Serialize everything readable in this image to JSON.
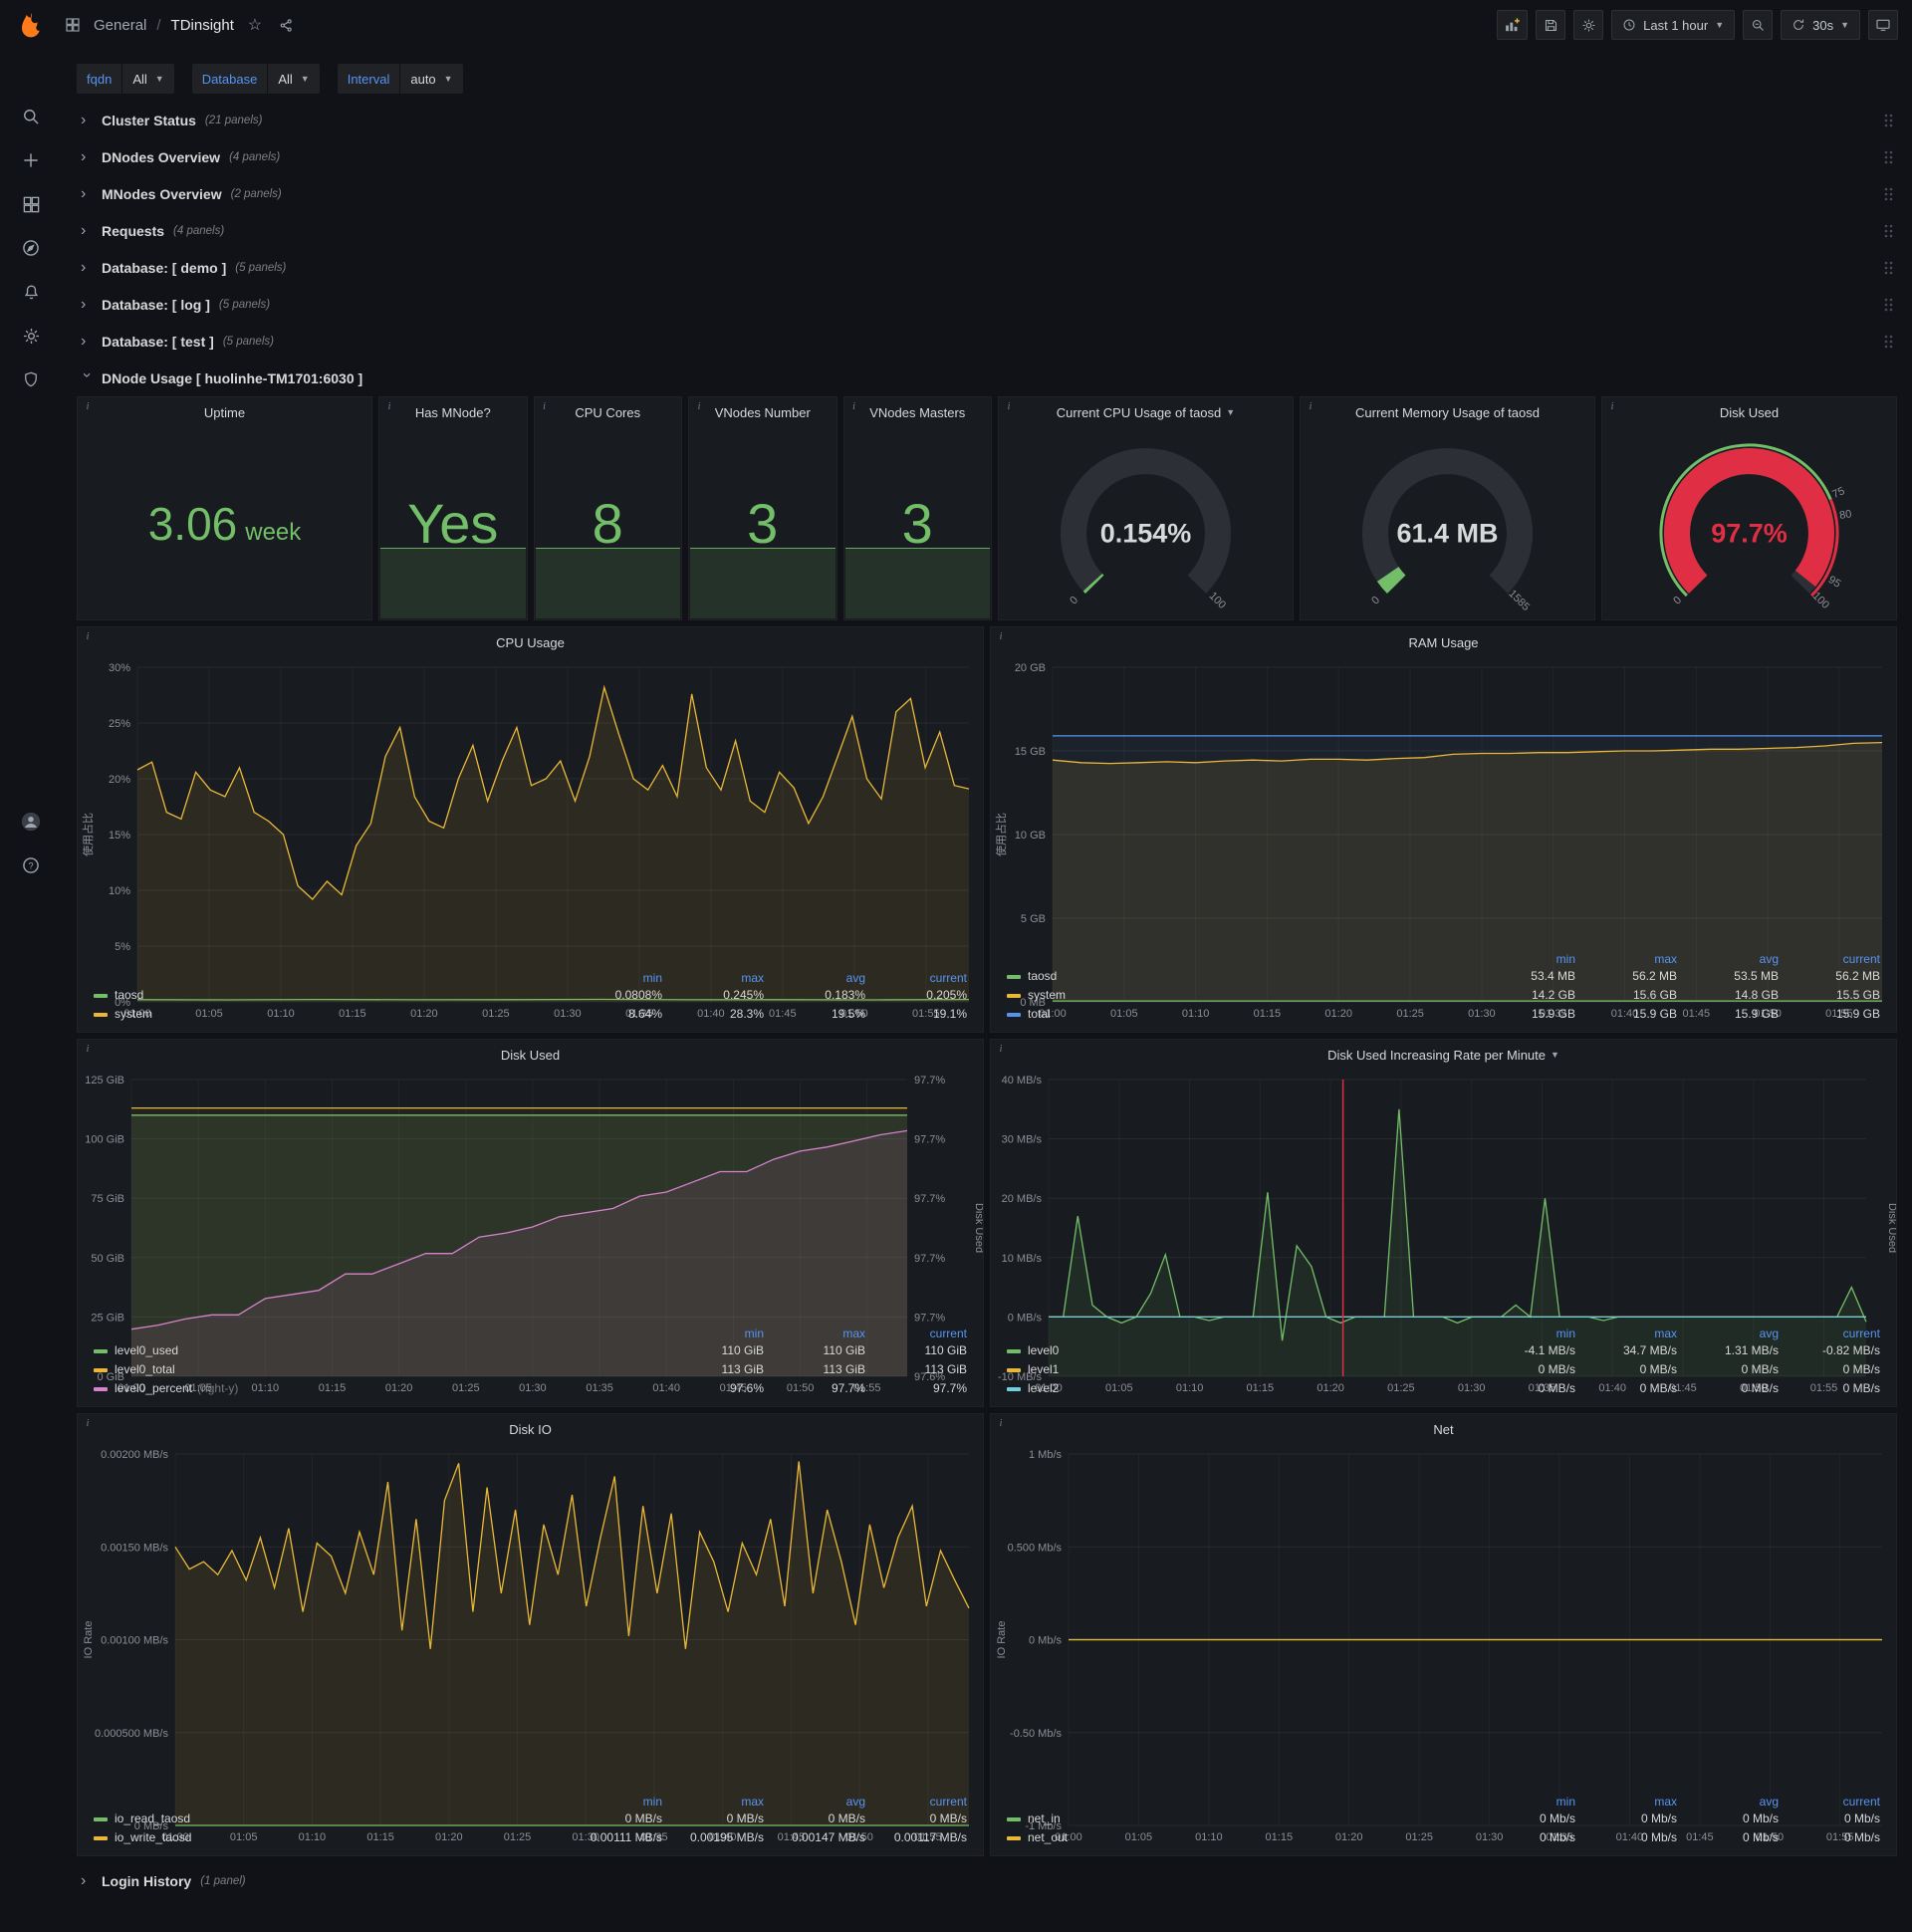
{
  "navbar": {
    "section": "General",
    "separator": "/",
    "title": "TDinsight",
    "time_range": "Last 1 hour",
    "refresh": "30s"
  },
  "filters": {
    "fqdn": {
      "label": "fqdn",
      "value": "All"
    },
    "database": {
      "label": "Database",
      "value": "All"
    },
    "interval": {
      "label": "Interval",
      "value": "auto"
    }
  },
  "rows": [
    {
      "title": "Cluster Status",
      "count": "(21 panels)"
    },
    {
      "title": "DNodes Overview",
      "count": "(4 panels)"
    },
    {
      "title": "MNodes Overview",
      "count": "(2 panels)"
    },
    {
      "title": "Requests",
      "count": "(4 panels)"
    },
    {
      "title": "Database: [ demo ]",
      "count": "(5 panels)"
    },
    {
      "title": "Database: [ log ]",
      "count": "(5 panels)"
    },
    {
      "title": "Database: [ test ]",
      "count": "(5 panels)"
    }
  ],
  "dnode_row": {
    "title": "DNode Usage [ huolinhe-TM1701:6030 ]"
  },
  "login_row": {
    "title": "Login History",
    "count": "(1 panel)"
  },
  "stats": {
    "uptime": {
      "title": "Uptime",
      "value": "3.06",
      "unit": "week"
    },
    "mnode": {
      "title": "Has MNode?",
      "value": "Yes"
    },
    "cores": {
      "title": "CPU Cores",
      "value": "8"
    },
    "vnodes": {
      "title": "VNodes Number",
      "value": "3"
    },
    "masters": {
      "title": "VNodes Masters",
      "value": "3"
    }
  },
  "gauges": {
    "cpu": {
      "title": "Current CPU Usage of taosd",
      "value": "0.154%",
      "fraction": 0.0022,
      "color": "#73bf69",
      "value_color": "#d8d9da",
      "threshold": false,
      "ticks": [
        {
          "v": 0,
          "label": "0"
        },
        {
          "v": 1,
          "label": "100"
        }
      ]
    },
    "mem": {
      "title": "Current Memory Usage of taosd",
      "value": "61.4 MB",
      "fraction": 0.039,
      "color": "#73bf69",
      "value_color": "#d8d9da",
      "threshold": false,
      "ticks": [
        {
          "v": 0,
          "label": "0"
        },
        {
          "v": 1,
          "label": "1585"
        }
      ]
    },
    "disk": {
      "title": "Disk Used",
      "value": "97.7%",
      "fraction": 0.977,
      "color": "#e02f44",
      "value_color": "#e02f44",
      "threshold": true,
      "ticks": [
        {
          "v": 0,
          "label": "0"
        },
        {
          "v": 0.75,
          "label": "75"
        },
        {
          "v": 0.8,
          "label": "80"
        },
        {
          "v": 0.95,
          "label": "95"
        },
        {
          "v": 1,
          "label": "100"
        }
      ]
    }
  },
  "charts": {
    "cpu": {
      "type": "line",
      "title": "CPU Usage",
      "y_label": "使用占比",
      "pad_left": 44,
      "y_min": 0,
      "y_max": 30,
      "y_ticks": [
        {
          "v": 0,
          "label": "0%"
        },
        {
          "v": 5,
          "label": "5%"
        },
        {
          "v": 10,
          "label": "10%"
        },
        {
          "v": 15,
          "label": "15%"
        },
        {
          "v": 20,
          "label": "20%"
        },
        {
          "v": 25,
          "label": "25%"
        },
        {
          "v": 30,
          "label": "30%"
        }
      ],
      "x_labels": [
        "01:00",
        "01:05",
        "01:10",
        "01:15",
        "01:20",
        "01:25",
        "01:30",
        "01:35",
        "01:40",
        "01:45",
        "01:50",
        "01:55"
      ],
      "series": [
        {
          "name": "taosd",
          "color": "#73bf69",
          "fill": 0,
          "values": [
            0.2,
            0.18,
            0.21,
            0.19,
            0.2,
            0.22,
            0.19,
            0.2,
            0.18,
            0.21
          ]
        },
        {
          "name": "system",
          "color": "#eab839",
          "fill": 0.1,
          "values": [
            20.8,
            21.5,
            17,
            16.4,
            20.6,
            19,
            18.4,
            21,
            17,
            16.2,
            15,
            10.4,
            9.2,
            10.8,
            9.6,
            14,
            16,
            22,
            24.6,
            18.4,
            16.2,
            15.6,
            20,
            23,
            18,
            21.6,
            24.6,
            19.4,
            20,
            21.6,
            18,
            22,
            28.2,
            24,
            20,
            19,
            21.2,
            18.4,
            27.6,
            21,
            19,
            23.4,
            18,
            17,
            20.6,
            19.2,
            16,
            18.4,
            22,
            25.6,
            20,
            18.2,
            26,
            27.2,
            21,
            24.2,
            19.4,
            19.1
          ]
        }
      ],
      "legend": {
        "columns": [
          "min",
          "max",
          "avg",
          "current"
        ],
        "rows": [
          {
            "name": "taosd",
            "color": "#73bf69",
            "values": [
              "0.0808%",
              "0.245%",
              "0.183%",
              "0.205%"
            ]
          },
          {
            "name": "system",
            "color": "#eab839",
            "values": [
              "8.64%",
              "28.3%",
              "19.5%",
              "19.1%"
            ]
          }
        ]
      }
    },
    "ram": {
      "type": "line",
      "title": "RAM Usage",
      "y_label": "使用占比",
      "pad_left": 46,
      "y_min": 0,
      "y_max": 20,
      "y_ticks": [
        {
          "v": 0,
          "label": "0 MB"
        },
        {
          "v": 5,
          "label": "5 GB"
        },
        {
          "v": 10,
          "label": "10 GB"
        },
        {
          "v": 15,
          "label": "15 GB"
        },
        {
          "v": 20,
          "label": "20 GB"
        }
      ],
      "x_labels": [
        "01:00",
        "01:05",
        "01:10",
        "01:15",
        "01:20",
        "01:25",
        "01:30",
        "01:35",
        "01:40",
        "01:45",
        "01:50",
        "01:55"
      ],
      "series": [
        {
          "name": "total",
          "color": "#5794f2",
          "fill": 0.06,
          "values": [
            15.9,
            15.9,
            15.9,
            15.9,
            15.9,
            15.9,
            15.9,
            15.9,
            15.9,
            15.9
          ]
        },
        {
          "name": "system",
          "color": "#eab839",
          "fill": 0.1,
          "values": [
            14.45,
            14.3,
            14.25,
            14.3,
            14.35,
            14.3,
            14.4,
            14.45,
            14.4,
            14.5,
            14.5,
            14.45,
            14.55,
            14.6,
            14.8,
            14.85,
            14.85,
            14.9,
            14.9,
            14.95,
            15.0,
            15.0,
            15.05,
            15.1,
            15.1,
            15.15,
            15.2,
            15.3,
            15.45,
            15.5
          ]
        },
        {
          "name": "taosd",
          "color": "#73bf69",
          "fill": 0,
          "values": [
            0.053,
            0.053,
            0.055,
            0.054,
            0.053,
            0.055,
            0.054,
            0.056
          ]
        }
      ],
      "legend": {
        "columns": [
          "min",
          "max",
          "avg",
          "current"
        ],
        "rows": [
          {
            "name": "taosd",
            "color": "#73bf69",
            "values": [
              "53.4 MB",
              "56.2 MB",
              "53.5 MB",
              "56.2 MB"
            ]
          },
          {
            "name": "system",
            "color": "#eab839",
            "values": [
              "14.2 GB",
              "15.6 GB",
              "14.8 GB",
              "15.5 GB"
            ]
          },
          {
            "name": "total",
            "color": "#5794f2",
            "values": [
              "15.9 GB",
              "15.9 GB",
              "15.9 GB",
              "15.9 GB"
            ]
          }
        ]
      }
    },
    "disk": {
      "type": "line",
      "title": "Disk Used",
      "pad_left": 54,
      "right_label": "Disk Used",
      "y_min": 0,
      "y_max": 125,
      "r_min": 97.59,
      "r_max": 97.735,
      "y_ticks": [
        {
          "v": 0,
          "label": "0 GiB"
        },
        {
          "v": 25,
          "label": "25 GiB"
        },
        {
          "v": 50,
          "label": "50 GiB"
        },
        {
          "v": 75,
          "label": "75 GiB"
        },
        {
          "v": 100,
          "label": "100 GiB"
        },
        {
          "v": 125,
          "label": "125 GiB"
        }
      ],
      "right_ticks": [
        "97.6%",
        "97.7%",
        "97.7%",
        "97.7%",
        "97.7%",
        "97.7%"
      ],
      "x_labels": [
        "01:00",
        "01:05",
        "01:10",
        "01:15",
        "01:20",
        "01:25",
        "01:30",
        "01:35",
        "01:40",
        "01:45",
        "01:50",
        "01:55"
      ],
      "series": [
        {
          "name": "level0_used",
          "color": "#73bf69",
          "fill": 0.12,
          "values": [
            110,
            110
          ]
        },
        {
          "name": "level0_total",
          "color": "#eab839",
          "fill": 0.05,
          "values": [
            113,
            113
          ]
        },
        {
          "name": "level0_percent",
          "color": "#d683ce",
          "fill": 0.1,
          "axis": "right",
          "values": [
            97.613,
            97.615,
            97.618,
            97.62,
            97.62,
            97.628,
            97.63,
            97.632,
            97.64,
            97.64,
            97.645,
            97.65,
            97.65,
            97.658,
            97.66,
            97.663,
            97.668,
            97.67,
            97.672,
            97.678,
            97.68,
            97.685,
            97.69,
            97.69,
            97.696,
            97.7,
            97.702,
            97.705,
            97.708,
            97.71
          ]
        }
      ],
      "legend": {
        "columns": [
          "min",
          "max",
          "current"
        ],
        "rows": [
          {
            "name": "level0_used",
            "color": "#73bf69",
            "values": [
              "110 GiB",
              "110 GiB",
              "110 GiB"
            ]
          },
          {
            "name": "level0_total",
            "color": "#eab839",
            "values": [
              "113 GiB",
              "113 GiB",
              "113 GiB"
            ]
          },
          {
            "name": "level0_percent",
            "color": "#d683ce",
            "note": "(right-y)",
            "values": [
              "97.6%",
              "97.7%",
              "97.7%"
            ]
          }
        ]
      }
    },
    "rate": {
      "type": "line",
      "title": "Disk Used Increasing Rate per Minute",
      "pad_left": 58,
      "right_label": "Disk Used",
      "annot_frac": 0.36,
      "y_min": -10,
      "y_max": 40,
      "y_ticks": [
        {
          "v": -10,
          "label": "-10 MB/s"
        },
        {
          "v": 0,
          "label": "0 MB/s"
        },
        {
          "v": 10,
          "label": "10 MB/s"
        },
        {
          "v": 20,
          "label": "20 MB/s"
        },
        {
          "v": 30,
          "label": "30 MB/s"
        },
        {
          "v": 40,
          "label": "40 MB/s"
        }
      ],
      "x_labels": [
        "01:00",
        "01:05",
        "01:10",
        "01:15",
        "01:20",
        "01:25",
        "01:30",
        "01:35",
        "01:40",
        "01:45",
        "01:50",
        "01:55"
      ],
      "series": [
        {
          "name": "level0",
          "color": "#73bf69",
          "fill": 0.1,
          "values": [
            0,
            0,
            17,
            2,
            0,
            -1,
            0,
            4,
            10.5,
            0,
            0,
            -0.6,
            0,
            0,
            0,
            21,
            -4,
            12,
            8.5,
            0,
            -1,
            0,
            0,
            0,
            35,
            0,
            0,
            0,
            -1,
            0,
            0,
            0,
            2,
            0,
            20,
            0,
            0,
            0,
            -0.6,
            0,
            0,
            0,
            0,
            0,
            0,
            0,
            0,
            0,
            0,
            0,
            0,
            0,
            0,
            0,
            0,
            5,
            -0.8
          ]
        },
        {
          "name": "level1",
          "color": "#eab839",
          "fill": 0,
          "values": [
            0,
            0
          ]
        },
        {
          "name": "level2",
          "color": "#6ed0e0",
          "fill": 0,
          "values": [
            0,
            0
          ]
        }
      ],
      "legend": {
        "columns": [
          "min",
          "max",
          "avg",
          "current"
        ],
        "rows": [
          {
            "name": "level0",
            "color": "#73bf69",
            "values": [
              "-4.1 MB/s",
              "34.7 MB/s",
              "1.31 MB/s",
              "-0.82 MB/s"
            ]
          },
          {
            "name": "level1",
            "color": "#eab839",
            "values": [
              "0 MB/s",
              "0 MB/s",
              "0 MB/s",
              "0 MB/s"
            ]
          },
          {
            "name": "level2",
            "color": "#6ed0e0",
            "values": [
              "0 MB/s",
              "0 MB/s",
              "0 MB/s",
              "0 MB/s"
            ]
          }
        ]
      }
    },
    "io": {
      "type": "line",
      "title": "Disk IO",
      "y_label": "IO Rate",
      "pad_left": 82,
      "y_min": 0,
      "y_max": 0.002,
      "y_ticks": [
        {
          "v": 0,
          "label": "0 MB/s"
        },
        {
          "v": 0.0005,
          "label": "0.000500 MB/s"
        },
        {
          "v": 0.001,
          "label": "0.00100 MB/s"
        },
        {
          "v": 0.0015,
          "label": "0.00150 MB/s"
        },
        {
          "v": 0.002,
          "label": "0.00200 MB/s"
        }
      ],
      "x_labels": [
        "01:00",
        "01:05",
        "01:10",
        "01:15",
        "01:20",
        "01:25",
        "01:30",
        "01:35",
        "01:40",
        "01:45",
        "01:50",
        "01:55"
      ],
      "series": [
        {
          "name": "io_read_taosd",
          "color": "#73bf69",
          "fill": 0,
          "values": [
            0,
            0
          ]
        },
        {
          "name": "io_write_taosd",
          "color": "#eab839",
          "fill": 0.1,
          "values": [
            0.0015,
            0.00138,
            0.00142,
            0.00135,
            0.00148,
            0.00132,
            0.00155,
            0.00128,
            0.0016,
            0.00115,
            0.00152,
            0.00145,
            0.00125,
            0.00158,
            0.00135,
            0.00185,
            0.00105,
            0.00165,
            0.00095,
            0.00175,
            0.00195,
            0.00115,
            0.00182,
            0.00125,
            0.0017,
            0.00108,
            0.00162,
            0.00135,
            0.00178,
            0.00118,
            0.00155,
            0.00188,
            0.00102,
            0.00172,
            0.00125,
            0.00168,
            0.00095,
            0.00158,
            0.00142,
            0.00115,
            0.00152,
            0.00135,
            0.00165,
            0.00118,
            0.00196,
            0.00125,
            0.0017,
            0.00142,
            0.00108,
            0.00162,
            0.00128,
            0.00155,
            0.00172,
            0.00118,
            0.00148,
            0.00132,
            0.00117
          ]
        }
      ],
      "legend": {
        "columns": [
          "min",
          "max",
          "avg",
          "current"
        ],
        "rows": [
          {
            "name": "io_read_taosd",
            "color": "#73bf69",
            "values": [
              "0 MB/s",
              "0 MB/s",
              "0 MB/s",
              "0 MB/s"
            ]
          },
          {
            "name": "io_write_taosd",
            "color": "#eab839",
            "values": [
              "0.00111 MB/s",
              "0.00195 MB/s",
              "0.00147 MB/s",
              "0.00117 MB/s"
            ]
          }
        ]
      }
    },
    "net": {
      "type": "line",
      "title": "Net",
      "y_label": "IO Rate",
      "pad_left": 62,
      "y_min": -1,
      "y_max": 1,
      "y_ticks": [
        {
          "v": -1,
          "label": "-1 Mb/s"
        },
        {
          "v": -0.5,
          "label": "-0.50 Mb/s"
        },
        {
          "v": 0,
          "label": "0 Mb/s"
        },
        {
          "v": 0.5,
          "label": "0.500 Mb/s"
        },
        {
          "v": 1,
          "label": "1 Mb/s"
        }
      ],
      "x_labels": [
        "01:00",
        "01:05",
        "01:10",
        "01:15",
        "01:20",
        "01:25",
        "01:30",
        "01:35",
        "01:40",
        "01:45",
        "01:50",
        "01:55"
      ],
      "series": [
        {
          "name": "net_in",
          "color": "#73bf69",
          "fill": 0,
          "values": [
            0,
            0
          ]
        },
        {
          "name": "net_out",
          "color": "#eab839",
          "fill": 0,
          "values": [
            0,
            0
          ]
        }
      ],
      "legend": {
        "columns": [
          "min",
          "max",
          "avg",
          "current"
        ],
        "rows": [
          {
            "name": "net_in",
            "color": "#73bf69",
            "values": [
              "0 Mb/s",
              "0 Mb/s",
              "0 Mb/s",
              "0 Mb/s"
            ]
          },
          {
            "name": "net_out",
            "color": "#eab839",
            "values": [
              "0 Mb/s",
              "0 Mb/s",
              "0 Mb/s",
              "0 Mb/s"
            ]
          }
        ]
      }
    }
  }
}
